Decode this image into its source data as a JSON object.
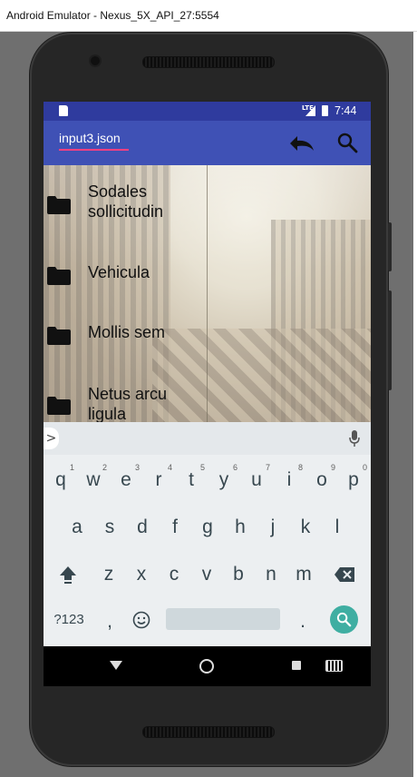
{
  "window": {
    "title": "Android Emulator - Nexus_5X_API_27:5554"
  },
  "statusbar": {
    "time": "7:44",
    "network": "LTE"
  },
  "appbar": {
    "file_name": "input3.json",
    "undo_icon": "undo-icon",
    "search_icon": "search-icon"
  },
  "list": {
    "items": [
      {
        "label": "Sodales sollicitudin",
        "icon": "folder-icon"
      },
      {
        "label": "Vehicula",
        "icon": "folder-icon"
      },
      {
        "label": "Mollis sem",
        "icon": "folder-icon"
      },
      {
        "label": "Netus arcu ligula",
        "icon": "folder-icon"
      }
    ]
  },
  "keyboard": {
    "row1": [
      "q",
      "w",
      "e",
      "r",
      "t",
      "y",
      "u",
      "i",
      "o",
      "p"
    ],
    "row1_hints": [
      "1",
      "2",
      "3",
      "4",
      "5",
      "6",
      "7",
      "8",
      "9",
      "0"
    ],
    "row2": [
      "a",
      "s",
      "d",
      "f",
      "g",
      "h",
      "j",
      "k",
      "l"
    ],
    "row3": [
      "z",
      "x",
      "c",
      "v",
      "b",
      "n",
      "m"
    ],
    "symbols_key": "?123",
    "comma_key": ",",
    "period_key": ".",
    "expand_key": ">"
  },
  "colors": {
    "primary": "#3f51b5",
    "primary_dark": "#2f3b9e",
    "accent": "#ff4081",
    "enter_key": "#3faea2"
  }
}
